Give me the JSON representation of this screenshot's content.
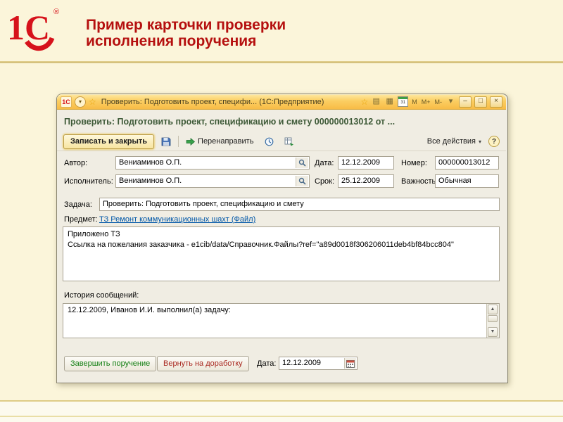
{
  "slide": {
    "title_line1": "Пример карточки проверки",
    "title_line2": "исполнения поручения",
    "logo_text": "1С",
    "logo_reg": "®"
  },
  "window": {
    "titlebar": {
      "title": "Проверить: Подготовить проект, специфи... (1С:Предприятие)",
      "memory": [
        "M",
        "M+",
        "M-"
      ]
    },
    "header": "Проверить: Подготовить проект, спецификацию и смету 000000013012 от ...",
    "toolbar": {
      "save_close": "Записать и закрыть",
      "redirect": "Перенаправить",
      "all_actions": "Все действия"
    },
    "fields": {
      "author": {
        "label": "Автор:",
        "value": "Вениаминов О.П."
      },
      "date": {
        "label": "Дата:",
        "value": "12.12.2009"
      },
      "number": {
        "label": "Номер:",
        "value": "000000013012"
      },
      "executor": {
        "label": "Исполнитель:",
        "value": "Вениаминов О.П."
      },
      "due": {
        "label": "Срок:",
        "value": "25.12.2009"
      },
      "importance": {
        "label": "Важность:",
        "value": "Обычная"
      },
      "task": {
        "label": "Задача:",
        "value": "Проверить: Подготовить проект, спецификацию и смету"
      },
      "subject": {
        "label": "Предмет:",
        "link": "ТЗ Ремонт коммуникационных шахт (Файл)"
      },
      "description": {
        "line1": "Приложено ТЗ",
        "line2": "Ссылка на пожелания заказчика - e1cib/data/Справочник.Файлы?ref=\"a89d0018f306206011deb4bf84bcc804\""
      },
      "history": {
        "label": "История сообщений:",
        "text": "12.12.2009, Иванов И.И. выполнил(а) задачу:"
      },
      "bottom_date": {
        "label": "Дата:",
        "value": "12.12.2009"
      }
    },
    "buttons": {
      "finish": "Завершить поручение",
      "return": "Вернуть на доработку"
    }
  },
  "icons": {
    "app": "1С",
    "dropdown": "▾",
    "star": "☆",
    "doc": "▤",
    "grid": "▦",
    "calendar_day": "31",
    "minimize": "–",
    "maximize": "□",
    "close": "×",
    "help": "?",
    "scroll_up": "▲",
    "scroll_down": "▼"
  },
  "colors": {
    "accent_red": "#B5100F",
    "header_green": "#3E5A38",
    "link_blue": "#0057A8",
    "finish_green": "#0E7C0E",
    "return_red": "#A8271E"
  }
}
